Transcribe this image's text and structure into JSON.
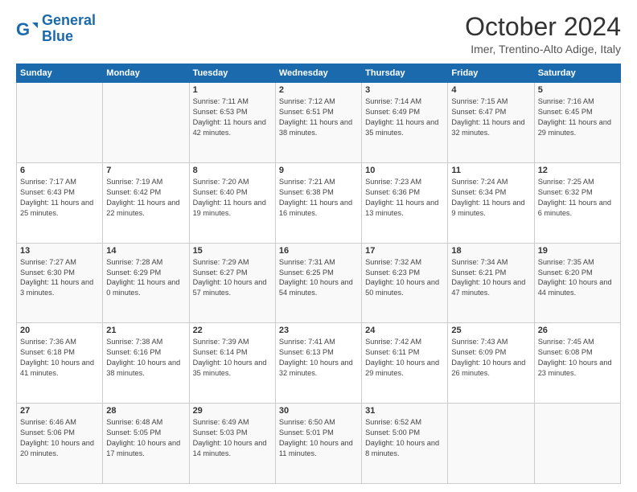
{
  "header": {
    "logo_general": "General",
    "logo_blue": "Blue",
    "month_title": "October 2024",
    "location": "Imer, Trentino-Alto Adige, Italy"
  },
  "days_of_week": [
    "Sunday",
    "Monday",
    "Tuesday",
    "Wednesday",
    "Thursday",
    "Friday",
    "Saturday"
  ],
  "weeks": [
    [
      {
        "day": "",
        "info": ""
      },
      {
        "day": "",
        "info": ""
      },
      {
        "day": "1",
        "info": "Sunrise: 7:11 AM\nSunset: 6:53 PM\nDaylight: 11 hours and 42 minutes."
      },
      {
        "day": "2",
        "info": "Sunrise: 7:12 AM\nSunset: 6:51 PM\nDaylight: 11 hours and 38 minutes."
      },
      {
        "day": "3",
        "info": "Sunrise: 7:14 AM\nSunset: 6:49 PM\nDaylight: 11 hours and 35 minutes."
      },
      {
        "day": "4",
        "info": "Sunrise: 7:15 AM\nSunset: 6:47 PM\nDaylight: 11 hours and 32 minutes."
      },
      {
        "day": "5",
        "info": "Sunrise: 7:16 AM\nSunset: 6:45 PM\nDaylight: 11 hours and 29 minutes."
      }
    ],
    [
      {
        "day": "6",
        "info": "Sunrise: 7:17 AM\nSunset: 6:43 PM\nDaylight: 11 hours and 25 minutes."
      },
      {
        "day": "7",
        "info": "Sunrise: 7:19 AM\nSunset: 6:42 PM\nDaylight: 11 hours and 22 minutes."
      },
      {
        "day": "8",
        "info": "Sunrise: 7:20 AM\nSunset: 6:40 PM\nDaylight: 11 hours and 19 minutes."
      },
      {
        "day": "9",
        "info": "Sunrise: 7:21 AM\nSunset: 6:38 PM\nDaylight: 11 hours and 16 minutes."
      },
      {
        "day": "10",
        "info": "Sunrise: 7:23 AM\nSunset: 6:36 PM\nDaylight: 11 hours and 13 minutes."
      },
      {
        "day": "11",
        "info": "Sunrise: 7:24 AM\nSunset: 6:34 PM\nDaylight: 11 hours and 9 minutes."
      },
      {
        "day": "12",
        "info": "Sunrise: 7:25 AM\nSunset: 6:32 PM\nDaylight: 11 hours and 6 minutes."
      }
    ],
    [
      {
        "day": "13",
        "info": "Sunrise: 7:27 AM\nSunset: 6:30 PM\nDaylight: 11 hours and 3 minutes."
      },
      {
        "day": "14",
        "info": "Sunrise: 7:28 AM\nSunset: 6:29 PM\nDaylight: 11 hours and 0 minutes."
      },
      {
        "day": "15",
        "info": "Sunrise: 7:29 AM\nSunset: 6:27 PM\nDaylight: 10 hours and 57 minutes."
      },
      {
        "day": "16",
        "info": "Sunrise: 7:31 AM\nSunset: 6:25 PM\nDaylight: 10 hours and 54 minutes."
      },
      {
        "day": "17",
        "info": "Sunrise: 7:32 AM\nSunset: 6:23 PM\nDaylight: 10 hours and 50 minutes."
      },
      {
        "day": "18",
        "info": "Sunrise: 7:34 AM\nSunset: 6:21 PM\nDaylight: 10 hours and 47 minutes."
      },
      {
        "day": "19",
        "info": "Sunrise: 7:35 AM\nSunset: 6:20 PM\nDaylight: 10 hours and 44 minutes."
      }
    ],
    [
      {
        "day": "20",
        "info": "Sunrise: 7:36 AM\nSunset: 6:18 PM\nDaylight: 10 hours and 41 minutes."
      },
      {
        "day": "21",
        "info": "Sunrise: 7:38 AM\nSunset: 6:16 PM\nDaylight: 10 hours and 38 minutes."
      },
      {
        "day": "22",
        "info": "Sunrise: 7:39 AM\nSunset: 6:14 PM\nDaylight: 10 hours and 35 minutes."
      },
      {
        "day": "23",
        "info": "Sunrise: 7:41 AM\nSunset: 6:13 PM\nDaylight: 10 hours and 32 minutes."
      },
      {
        "day": "24",
        "info": "Sunrise: 7:42 AM\nSunset: 6:11 PM\nDaylight: 10 hours and 29 minutes."
      },
      {
        "day": "25",
        "info": "Sunrise: 7:43 AM\nSunset: 6:09 PM\nDaylight: 10 hours and 26 minutes."
      },
      {
        "day": "26",
        "info": "Sunrise: 7:45 AM\nSunset: 6:08 PM\nDaylight: 10 hours and 23 minutes."
      }
    ],
    [
      {
        "day": "27",
        "info": "Sunrise: 6:46 AM\nSunset: 5:06 PM\nDaylight: 10 hours and 20 minutes."
      },
      {
        "day": "28",
        "info": "Sunrise: 6:48 AM\nSunset: 5:05 PM\nDaylight: 10 hours and 17 minutes."
      },
      {
        "day": "29",
        "info": "Sunrise: 6:49 AM\nSunset: 5:03 PM\nDaylight: 10 hours and 14 minutes."
      },
      {
        "day": "30",
        "info": "Sunrise: 6:50 AM\nSunset: 5:01 PM\nDaylight: 10 hours and 11 minutes."
      },
      {
        "day": "31",
        "info": "Sunrise: 6:52 AM\nSunset: 5:00 PM\nDaylight: 10 hours and 8 minutes."
      },
      {
        "day": "",
        "info": ""
      },
      {
        "day": "",
        "info": ""
      }
    ]
  ]
}
